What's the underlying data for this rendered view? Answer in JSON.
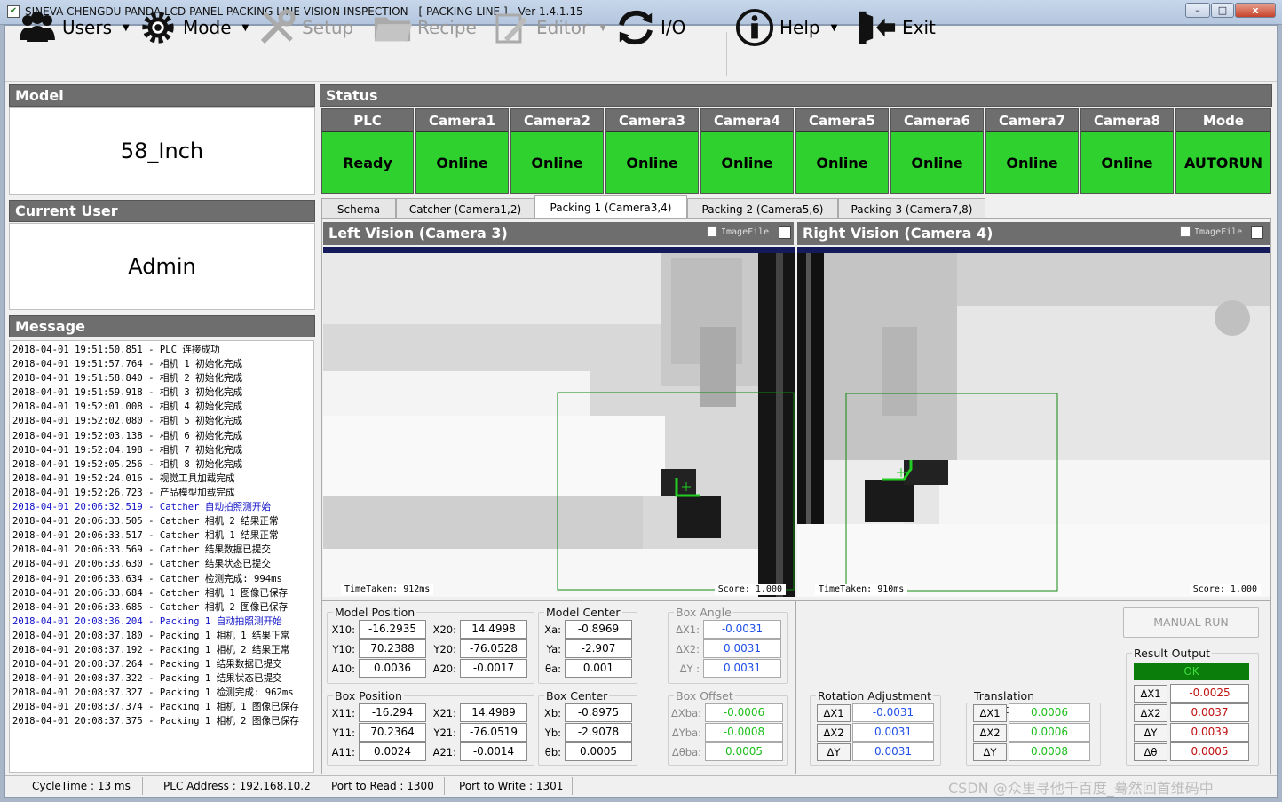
{
  "window": {
    "title": "SINEVA CHENGDU PANDA LCD PANEL PACKING LINE VISION INSPECTION - [ PACKING LINE ] - Ver 1.4.1.15",
    "minimize": "–",
    "maximize": "□",
    "close": "x"
  },
  "toolbar": {
    "users": "Users",
    "mode": "Mode",
    "setup": "Setup",
    "recipe": "Recipe",
    "editor": "Editor",
    "io": "I/O",
    "help": "Help",
    "exit": "Exit"
  },
  "model": {
    "header": "Model",
    "value": "58_Inch"
  },
  "current_user": {
    "header": "Current User",
    "value": "Admin"
  },
  "message": {
    "header": "Message",
    "lines": [
      "2018-04-01 19:51:50.851 - PLC 连接成功",
      "2018-04-01 19:51:57.764 - 相机 1 初始化完成",
      "2018-04-01 19:51:58.840 - 相机 2 初始化完成",
      "2018-04-01 19:51:59.918 - 相机 3 初始化完成",
      "2018-04-01 19:52:01.008 - 相机 4 初始化完成",
      "2018-04-01 19:52:02.080 - 相机 5 初始化完成",
      "2018-04-01 19:52:03.138 - 相机 6 初始化完成",
      "2018-04-01 19:52:04.198 - 相机 7 初始化完成",
      "2018-04-01 19:52:05.256 - 相机 8 初始化完成",
      "2018-04-01 19:52:24.016 - 视觉工具加载完成",
      "2018-04-01 19:52:26.723 - 产品模型加载完成",
      "2018-04-01 20:06:32.519 - Catcher 自动拍照测开始",
      "2018-04-01 20:06:33.505 - Catcher 相机 2 结果正常",
      "2018-04-01 20:06:33.517 - Catcher 相机 1 结果正常",
      "2018-04-01 20:06:33.569 - Catcher 结果数据已提交",
      "2018-04-01 20:06:33.630 - Catcher 结果状态已提交",
      "2018-04-01 20:06:33.634 - Catcher 检测完成: 994ms",
      "2018-04-01 20:06:33.684 - Catcher 相机 1 图像已保存",
      "2018-04-01 20:06:33.685 - Catcher 相机 2 图像已保存",
      "2018-04-01 20:08:36.204 - Packing 1 自动拍照测开始",
      "2018-04-01 20:08:37.180 - Packing 1 相机 1 结果正常",
      "2018-04-01 20:08:37.192 - Packing 1 相机 2 结果正常",
      "2018-04-01 20:08:37.264 - Packing 1 结果数据已提交",
      "2018-04-01 20:08:37.322 - Packing 1 结果状态已提交",
      "2018-04-01 20:08:37.327 - Packing 1 检测完成: 962ms",
      "2018-04-01 20:08:37.374 - Packing 1 相机 1 图像已保存",
      "2018-04-01 20:08:37.375 - Packing 1 相机 2 图像已保存"
    ]
  },
  "status": {
    "header": "Status",
    "columns": [
      {
        "name": "PLC",
        "value": "Ready"
      },
      {
        "name": "Camera1",
        "value": "Online"
      },
      {
        "name": "Camera2",
        "value": "Online"
      },
      {
        "name": "Camera3",
        "value": "Online"
      },
      {
        "name": "Camera4",
        "value": "Online"
      },
      {
        "name": "Camera5",
        "value": "Online"
      },
      {
        "name": "Camera6",
        "value": "Online"
      },
      {
        "name": "Camera7",
        "value": "Online"
      },
      {
        "name": "Camera8",
        "value": "Online"
      },
      {
        "name": "Mode",
        "value": "AUTORUN"
      }
    ],
    "ok_color": "#2ed12e"
  },
  "tabs": [
    "Schema",
    "Catcher (Camera1,2)",
    "Packing 1 (Camera3,4)",
    "Packing 2 (Camera5,6)",
    "Packing 3 (Camera7,8)"
  ],
  "left_view": {
    "title": "Left Vision (Camera 3)",
    "imagefile": "ImageFile",
    "time": "TimeTaken: 912ms",
    "score": "Score: 1.000"
  },
  "right_view": {
    "title": "Right Vision (Camera 4)",
    "imagefile": "ImageFile",
    "time": "TimeTaken: 910ms",
    "score": "Score: 1.000"
  },
  "model_position": {
    "legend": "Model Position",
    "x10_l": "X10:",
    "x10": "-16.2935",
    "x20_l": "X20:",
    "x20": "14.4998",
    "y10_l": "Y10:",
    "y10": "70.2388",
    "y20_l": "Y20:",
    "y20": "-76.0528",
    "a10_l": "A10:",
    "a10": "0.0036",
    "a20_l": "A20:",
    "a20": "-0.0017"
  },
  "model_center": {
    "legend": "Model Center",
    "xa_l": "Xa:",
    "xa": "-0.8969",
    "ya_l": "Ya:",
    "ya": "-2.907",
    "ta_l": "θa:",
    "ta": "0.001"
  },
  "box_angle": {
    "legend": "Box Angle",
    "dx1_l": "ΔX1:",
    "dx1": "-0.0031",
    "dx2_l": "ΔX2:",
    "dx2": "0.0031",
    "dy_l": "ΔY :",
    "dy": "0.0031"
  },
  "box_position": {
    "legend": "Box Position",
    "x11_l": "X11:",
    "x11": "-16.294",
    "x21_l": "X21:",
    "x21": "14.4989",
    "y11_l": "Y11:",
    "y11": "70.2364",
    "y21_l": "Y21:",
    "y21": "-76.0519",
    "a11_l": "A11:",
    "a11": "0.0024",
    "a21_l": "A21:",
    "a21": "-0.0014"
  },
  "box_center": {
    "legend": "Box Center",
    "xb_l": "Xb:",
    "xb": "-0.8975",
    "yb_l": "Yb:",
    "yb": "-2.9078",
    "tb_l": "θb:",
    "tb": "0.0005"
  },
  "box_offset": {
    "legend": "Box Offset",
    "dxba_l": "ΔXba:",
    "dxba": "-0.0006",
    "dyba_l": "ΔYba:",
    "dyba": "-0.0008",
    "dtba_l": "Δθba:",
    "dtba": "0.0005"
  },
  "rotation_adjustment": {
    "legend": "Rotation Adjustment",
    "r1_l": "ΔX1",
    "r1": "-0.0031",
    "r2_l": "ΔX2",
    "r2": "0.0031",
    "r3_l": "ΔY",
    "r3": "0.0031"
  },
  "translation_adjustment": {
    "legend": "Translation Adjustment",
    "t1_l": "ΔX1",
    "t1": "0.0006",
    "t2_l": "ΔX2",
    "t2": "0.0006",
    "t3_l": "ΔY",
    "t3": "0.0008"
  },
  "manual_run": "MANUAL RUN",
  "result_output": {
    "legend": "Result Output",
    "ok": "OK",
    "o1_l": "ΔX1",
    "o1": "-0.0025",
    "o2_l": "ΔX2",
    "o2": "0.0037",
    "o3_l": "ΔY",
    "o3": "0.0039",
    "o4_l": "Δθ",
    "o4": "0.0005"
  },
  "statusbar": {
    "cycle": "CycleTime : 13 ms",
    "plc": "PLC Address : 192.168.10.2",
    "read": "Port to Read : 1300",
    "write": "Port to Write : 1301"
  },
  "watermark": "CSDN @众里寻他千百度_蓦然回首维码中"
}
